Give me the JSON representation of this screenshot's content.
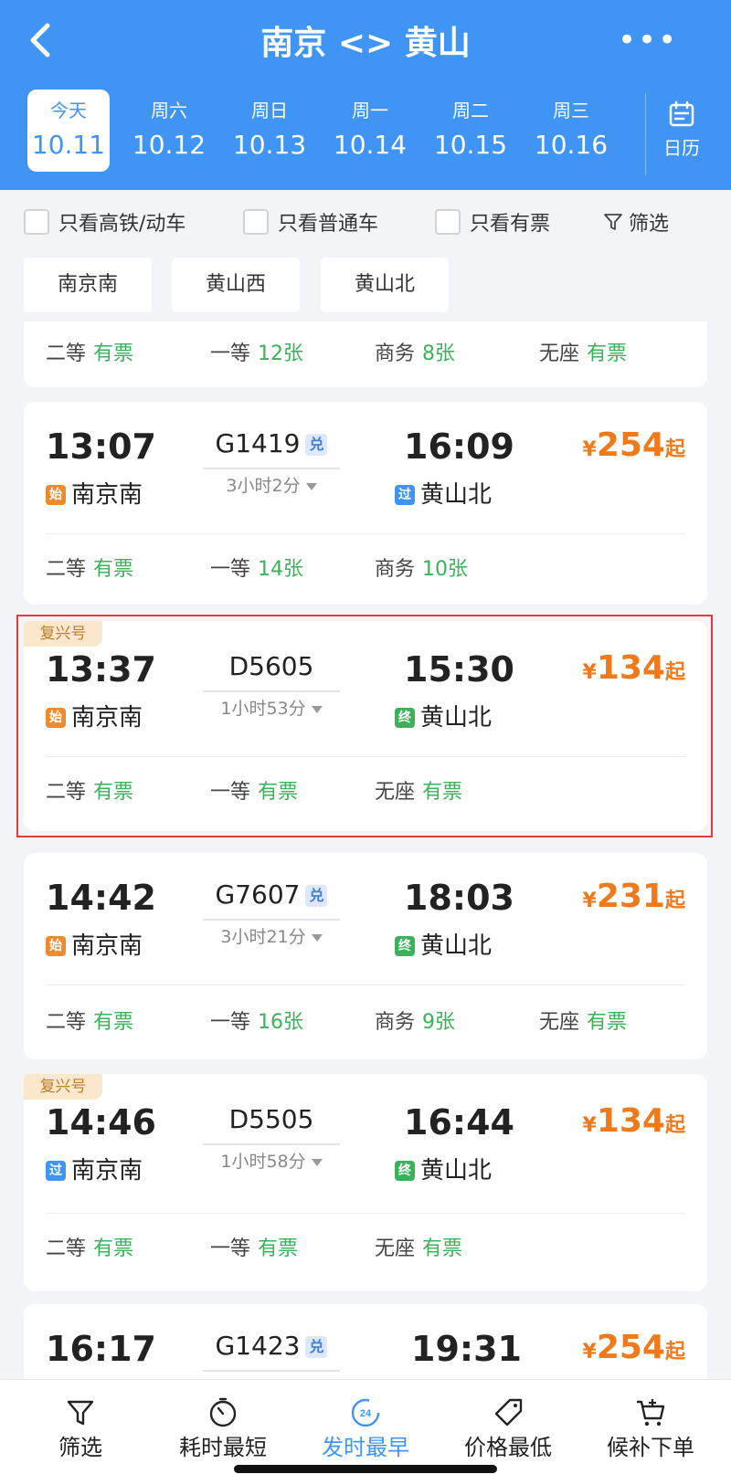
{
  "header": {
    "back_icon": "back-arrow-icon",
    "title": "南京 <> 黄山",
    "more_label": "•••"
  },
  "dates": [
    {
      "weekday": "今天",
      "date": "10.11",
      "active": true
    },
    {
      "weekday": "周六",
      "date": "10.12"
    },
    {
      "weekday": "周日",
      "date": "10.13"
    },
    {
      "weekday": "周一",
      "date": "10.14"
    },
    {
      "weekday": "周二",
      "date": "10.15"
    },
    {
      "weekday": "周三",
      "date": "10.16"
    }
  ],
  "calendar": {
    "label": "日历"
  },
  "filters": {
    "high_speed": "只看高铁/动车",
    "normal": "只看普通车",
    "available": "只看有票",
    "filter": "筛选"
  },
  "stations": [
    "南京南",
    "黄山西",
    "黄山北"
  ],
  "partial_card": {
    "seats": [
      {
        "type": "二等",
        "value": "有票"
      },
      {
        "type": "一等",
        "value": "12张"
      },
      {
        "type": "商务",
        "value": "8张"
      },
      {
        "type": "无座",
        "value": "有票"
      }
    ]
  },
  "trains": [
    {
      "dep_time": "13:07",
      "dep_station": "南京南",
      "dep_tag": "始",
      "train_no": "G1419",
      "exchange": "兑",
      "duration": "3小时2分",
      "arr_time": "16:09",
      "arr_station": "黄山北",
      "arr_tag": "过",
      "price_symbol": "¥",
      "price": "254",
      "price_suffix": "起",
      "seats": [
        {
          "type": "二等",
          "value": "有票"
        },
        {
          "type": "一等",
          "value": "14张"
        },
        {
          "type": "商务",
          "value": "10张"
        }
      ]
    },
    {
      "badge": "复兴号",
      "dep_time": "13:37",
      "dep_station": "南京南",
      "dep_tag": "始",
      "train_no": "D5605",
      "duration": "1小时53分",
      "arr_time": "15:30",
      "arr_station": "黄山北",
      "arr_tag": "终",
      "price_symbol": "¥",
      "price": "134",
      "price_suffix": "起",
      "seats": [
        {
          "type": "二等",
          "value": "有票"
        },
        {
          "type": "一等",
          "value": "有票"
        },
        {
          "type": "无座",
          "value": "有票"
        }
      ]
    },
    {
      "dep_time": "14:42",
      "dep_station": "南京南",
      "dep_tag": "始",
      "train_no": "G7607",
      "exchange": "兑",
      "duration": "3小时21分",
      "arr_time": "18:03",
      "arr_station": "黄山北",
      "arr_tag": "终",
      "price_symbol": "¥",
      "price": "231",
      "price_suffix": "起",
      "seats": [
        {
          "type": "二等",
          "value": "有票"
        },
        {
          "type": "一等",
          "value": "16张"
        },
        {
          "type": "商务",
          "value": "9张"
        },
        {
          "type": "无座",
          "value": "有票"
        }
      ]
    },
    {
      "badge": "复兴号",
      "dep_time": "14:46",
      "dep_station": "南京南",
      "dep_tag": "过",
      "train_no": "D5505",
      "duration": "1小时58分",
      "arr_time": "16:44",
      "arr_station": "黄山北",
      "arr_tag": "终",
      "price_symbol": "¥",
      "price": "134",
      "price_suffix": "起",
      "seats": [
        {
          "type": "二等",
          "value": "有票"
        },
        {
          "type": "一等",
          "value": "有票"
        },
        {
          "type": "无座",
          "value": "有票"
        }
      ]
    },
    {
      "dep_time": "16:17",
      "train_no": "G1423",
      "exchange": "兑",
      "arr_time": "19:31",
      "price_symbol": "¥",
      "price": "254",
      "price_suffix": "起"
    }
  ],
  "bottom_nav": [
    {
      "label": "筛选",
      "icon": "filter-icon"
    },
    {
      "label": "耗时最短",
      "icon": "timer-icon"
    },
    {
      "label": "发时最早",
      "icon": "clock-24-icon",
      "active": true,
      "icon_text": "24"
    },
    {
      "label": "价格最低",
      "icon": "price-tag-icon"
    },
    {
      "label": "候补下单",
      "icon": "cart-icon"
    }
  ],
  "colors": {
    "primary": "#3f94f4",
    "available": "#3bb15a",
    "price": "#f07a1a",
    "highlight": "#e23b3b"
  }
}
